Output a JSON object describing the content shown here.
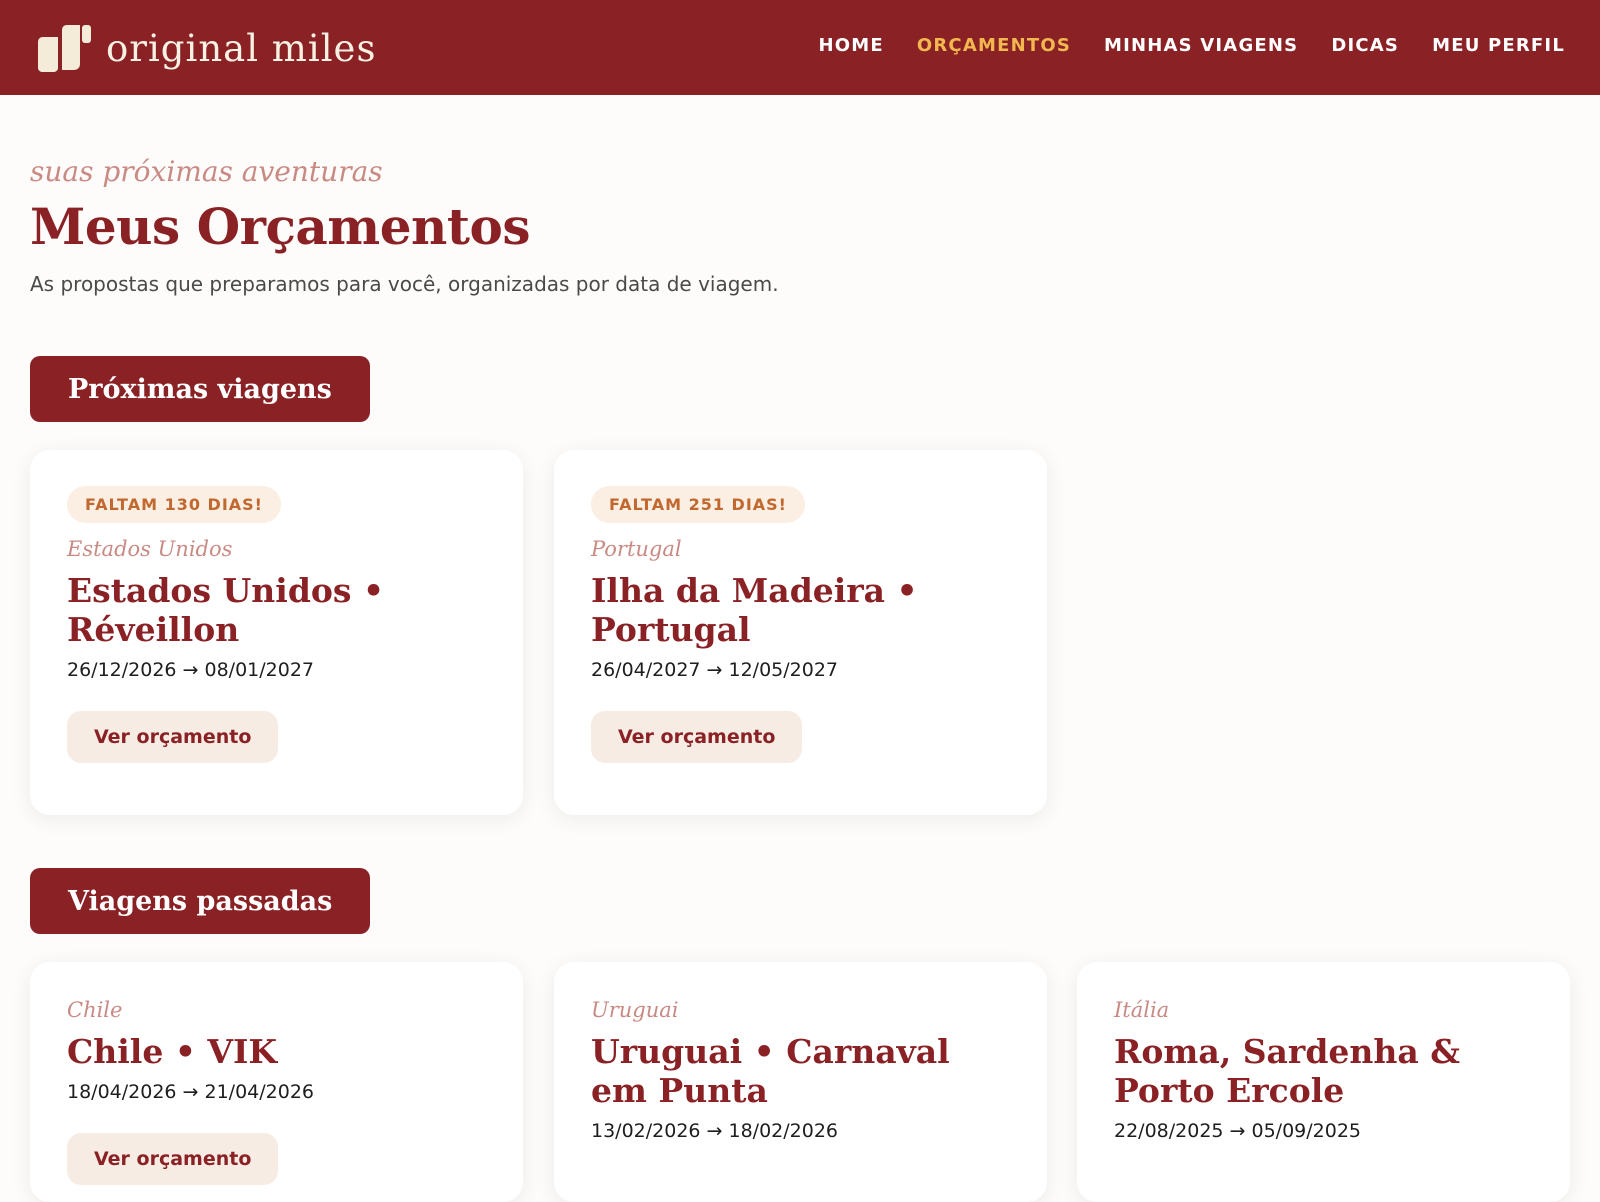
{
  "colors": {
    "brand": "#8a2125",
    "nav_active": "#f2b84f",
    "accent_text": "#c98a84",
    "badge_text": "#c1682f",
    "badge_bg": "#fbeee2",
    "button_bg": "#f6ece4",
    "page_bg": "#fdfcfa"
  },
  "header": {
    "logo_text": "original miles",
    "logo_icon": "original-miles-logo-icon",
    "nav": [
      {
        "label": "HOME",
        "active": false
      },
      {
        "label": "ORÇAMENTOS",
        "active": true
      },
      {
        "label": "MINHAS VIAGENS",
        "active": false
      },
      {
        "label": "DICAS",
        "active": false
      },
      {
        "label": "MEU PERFIL",
        "active": false
      }
    ]
  },
  "page": {
    "eyebrow": "suas próximas aventuras",
    "title": "Meus Orçamentos",
    "subtitle": "As propostas que preparamos para você, organizadas por data de viagem."
  },
  "upcoming": {
    "heading": "Próximas viagens",
    "trips": [
      {
        "badge": "FALTAM 130 DIAS!",
        "country": "Estados Unidos",
        "title": "Estados Unidos • Réveillon",
        "dates": "26/12/2026 → 08/01/2027",
        "button": "Ver orçamento"
      },
      {
        "badge": "FALTAM 251 DIAS!",
        "country": "Portugal",
        "title": "Ilha da Madeira • Portugal",
        "dates": "26/04/2027 → 12/05/2027",
        "button": "Ver orçamento"
      }
    ]
  },
  "past": {
    "heading": "Viagens passadas",
    "trips": [
      {
        "country": "Chile",
        "title": "Chile • VIK",
        "dates": "18/04/2026 → 21/04/2026",
        "button": "Ver orçamento"
      },
      {
        "country": "Uruguai",
        "title": "Uruguai • Carnaval em Punta",
        "dates": "13/02/2026 → 18/02/2026"
      },
      {
        "country": "Itália",
        "title": "Roma, Sardenha & Porto Ercole",
        "dates": "22/08/2025 → 05/09/2025"
      }
    ]
  }
}
